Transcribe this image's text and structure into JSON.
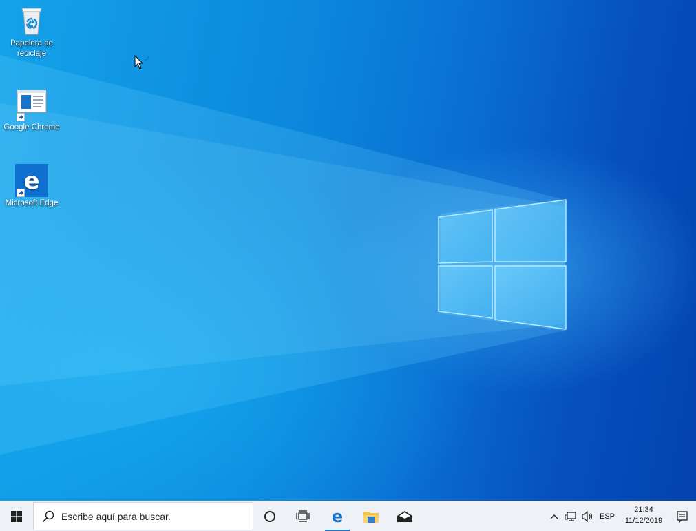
{
  "desktop": {
    "icons": [
      {
        "label": "Papelera de reciclaje"
      },
      {
        "label": "Google Chrome"
      },
      {
        "label": "Microsoft Edge"
      }
    ]
  },
  "taskbar": {
    "search_placeholder": "Escribe aquí para buscar.",
    "tray": {
      "language": "ESP",
      "time": "21:34",
      "date": "11/12/2019"
    }
  },
  "colors": {
    "desktop_light": "#14a3ea",
    "desktop_dark": "#0343ae",
    "taskbar_bg": "#eef2f6",
    "accent": "#1a73c9"
  },
  "icons": [
    "recycle-bin-icon",
    "chrome-icon",
    "edge-icon",
    "shortcut-arrow-icon",
    "windows-logo-icon",
    "search-icon",
    "cortana-icon",
    "task-view-icon",
    "file-explorer-icon",
    "mail-icon",
    "chevron-up-icon",
    "network-icon",
    "volume-icon",
    "notification-icon"
  ]
}
